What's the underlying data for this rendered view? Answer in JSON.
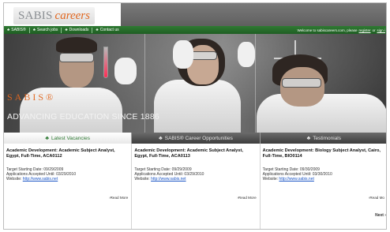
{
  "header": {
    "logo_part1": "SABIS",
    "logo_part2": "careers"
  },
  "nav": {
    "items": [
      {
        "label": "SABIS®"
      },
      {
        "label": "Search jobs"
      },
      {
        "label": "Downloads"
      },
      {
        "label": "Contact us"
      }
    ],
    "welcome": "Welcome to sabiscareers.com, please",
    "register": "register",
    "or": "or",
    "signin": "sign i"
  },
  "hero": {
    "brand": "SABIS®",
    "tagline": "ADVANCING EDUCATION SINCE 1886"
  },
  "tabs": [
    {
      "label": "Latest Vacancies"
    },
    {
      "label": "SABIS® Career Opportunities"
    },
    {
      "label": "Testimonials"
    }
  ],
  "listings": [
    {
      "title": "Academic Development: Academic Subject Analyst, Egypt, Full-Time, ACA0112",
      "start": "Target Starting Date: 09/29/2009",
      "accepted": "Applications Accepted Until: 03/29/2010",
      "website_label": "Website:",
      "website": "http://www.sabis.net",
      "readmore": "›Read More"
    },
    {
      "title": "Academic Development: Academic Subject Analyst, Egypt, Full-Time, ACA0113",
      "start": "Target Starting Date: 09/29/2009",
      "accepted": "Applications Accepted Until: 03/29/2010",
      "website_label": "Website:",
      "website": "http://www.sabis.net",
      "readmore": "›Read More"
    },
    {
      "title": "Academic Development: Biology Subject Analyst, Cairo, Full-Time, BIO0114",
      "start": "Target Starting Date: 09/30/2009",
      "accepted": "Applications Accepted Until: 03/30/2010",
      "website_label": "Website:",
      "website": "http://www.sabis.net",
      "readmore": "›Read Mo"
    }
  ],
  "next_label": "Next ›",
  "colors": {
    "nav_green": "#2f7a33",
    "logo_orange": "#e2671f",
    "link_blue": "#1a55c5"
  },
  "icons": {
    "nav": "tree-icon",
    "tab": "tree-icon"
  }
}
